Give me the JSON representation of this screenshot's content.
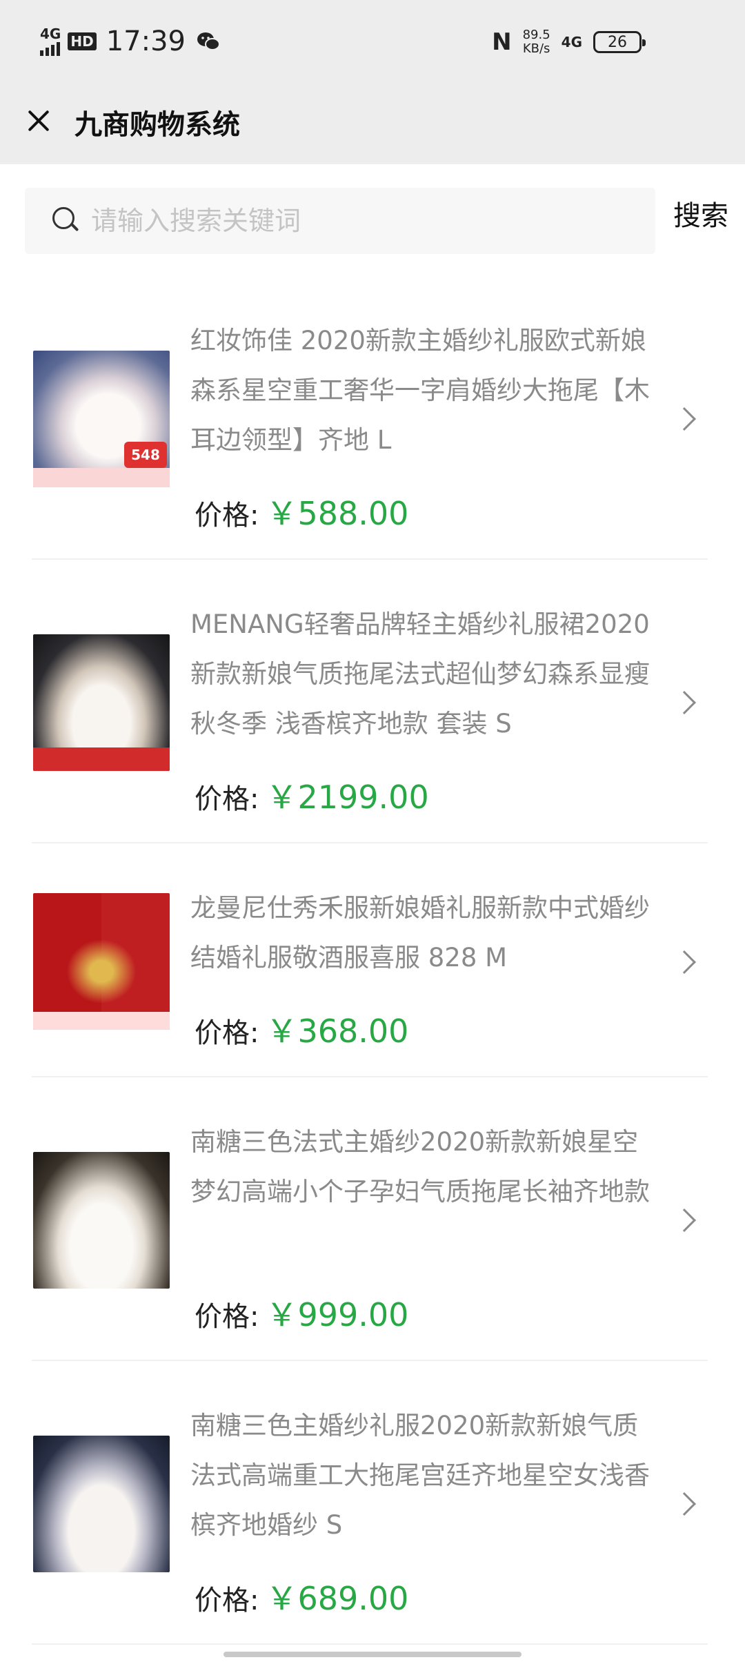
{
  "status_bar": {
    "network": "4G",
    "hd": "HD",
    "time": "17:39",
    "speed_value": "89.5",
    "speed_unit": "KB/s",
    "network_right": "4G",
    "battery": "26"
  },
  "header": {
    "title": "九商购物系统"
  },
  "search": {
    "placeholder": "请输入搜索关键词",
    "value": "",
    "button_label": "搜索"
  },
  "products": [
    {
      "title": "红妆饰佳 2020新款主婚纱礼服欧式新娘森系星空重工奢华一字肩婚纱大拖尾【木耳边领型】齐地 L",
      "price_label": "价格:",
      "price": "￥588.00",
      "thumb_text": "548"
    },
    {
      "title": "MENANG轻奢品牌轻主婚纱礼服裙2020新款新娘气质拖尾法式超仙梦幻森系显瘦秋冬季 浅香槟齐地款 套装 S",
      "price_label": "价格:",
      "price": "￥2199.00"
    },
    {
      "title": "龙曼尼仕秀禾服新娘婚礼服新款中式婚纱结婚礼服敬酒服喜服 828 M",
      "price_label": "价格:",
      "price": "￥368.00"
    },
    {
      "title": "南糖三色法式主婚纱2020新款新娘星空梦幻高端小个子孕妇气质拖尾长袖齐地款",
      "price_label": "价格:",
      "price": "￥999.00"
    },
    {
      "title": "南糖三色主婚纱礼服2020新款新娘气质法式高端重工大拖尾宫廷齐地星空女浅香槟齐地婚纱 S",
      "price_label": "价格:",
      "price": "￥689.00"
    }
  ]
}
